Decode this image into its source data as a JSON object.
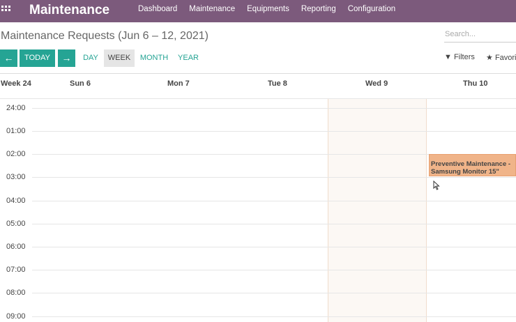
{
  "app": {
    "brand": "Maintenance",
    "menu": [
      "Dashboard",
      "Maintenance",
      "Equipments",
      "Reporting",
      "Configuration"
    ]
  },
  "control": {
    "title": "Maintenance Requests (Jun 6 – 12, 2021)",
    "search_placeholder": "Search...",
    "today_label": "TODAY",
    "scales": [
      "DAY",
      "WEEK",
      "MONTH",
      "YEAR"
    ],
    "active_scale": "WEEK",
    "filters_label": "Filters",
    "favorites_label": "Favori"
  },
  "calendar": {
    "week_label": "Week 24",
    "days": [
      "Sun 6",
      "Mon 7",
      "Tue 8",
      "Wed 9",
      "Thu 10"
    ],
    "today": "Wed 9",
    "hours": [
      "24:00",
      "01:00",
      "02:00",
      "03:00",
      "04:00",
      "05:00",
      "06:00",
      "07:00",
      "08:00",
      "09:00"
    ],
    "event": {
      "line1": "Preventive Maintenance -",
      "line2": "Samsung Monitor 15\"",
      "day": "Thu 10",
      "start": "02:00",
      "end": "03:00",
      "color": "#f0b489"
    }
  },
  "colors": {
    "nav": "#7c5a7c",
    "accent": "#25a494"
  }
}
